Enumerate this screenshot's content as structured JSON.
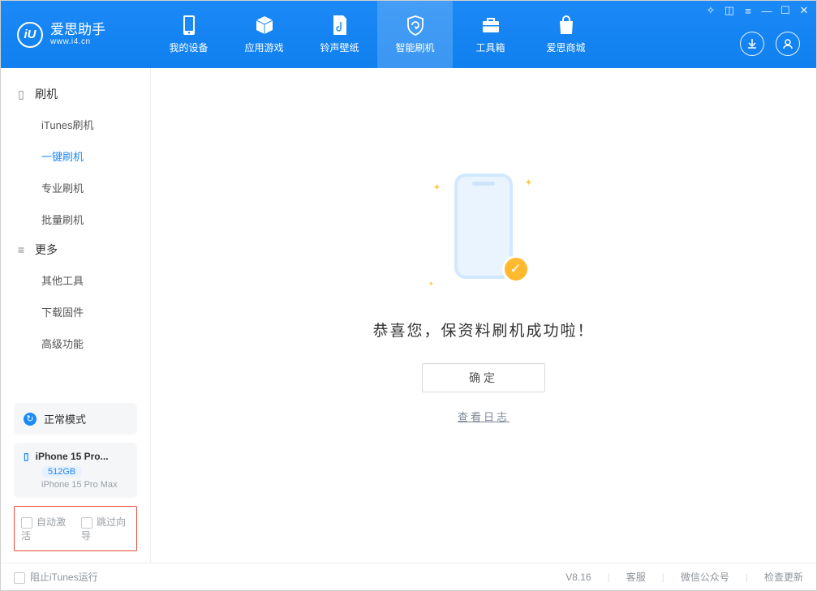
{
  "app": {
    "title": "爱思助手",
    "subtitle": "www.i4.cn"
  },
  "nav": {
    "items": [
      {
        "id": "device",
        "label": "我的设备"
      },
      {
        "id": "apps",
        "label": "应用游戏"
      },
      {
        "id": "ringtone",
        "label": "铃声壁纸"
      },
      {
        "id": "flash",
        "label": "智能刷机"
      },
      {
        "id": "toolbox",
        "label": "工具箱"
      },
      {
        "id": "store",
        "label": "爱思商城"
      }
    ],
    "active_index": 3
  },
  "sidebar": {
    "groups": [
      {
        "title": "刷机",
        "items": [
          "iTunes刷机",
          "一键刷机",
          "专业刷机",
          "批量刷机"
        ],
        "active_index": 1
      },
      {
        "title": "更多",
        "items": [
          "其他工具",
          "下载固件",
          "高级功能"
        ],
        "active_index": -1
      }
    ],
    "mode_label": "正常模式",
    "device": {
      "name": "iPhone 15 Pro...",
      "storage": "512GB",
      "full_name": "iPhone 15 Pro Max"
    },
    "options": {
      "auto_activate": "自动激活",
      "skip_guide": "跳过向导"
    }
  },
  "main": {
    "success_message": "恭喜您，保资料刷机成功啦！",
    "ok_button": "确定",
    "log_link": "查看日志"
  },
  "footer": {
    "block_itunes": "阻止iTunes运行",
    "version": "V8.16",
    "links": [
      "客服",
      "微信公众号",
      "检查更新"
    ]
  }
}
